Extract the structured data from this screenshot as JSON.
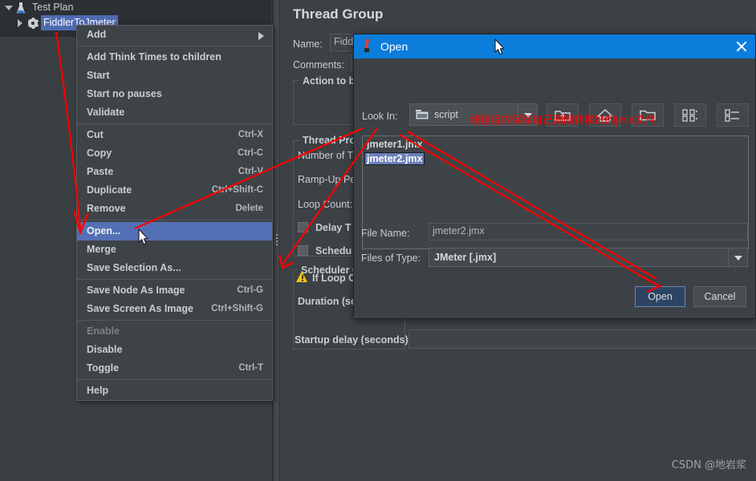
{
  "tree": {
    "nodes": [
      {
        "label": "Test Plan",
        "icon": "flask-icon",
        "expanded": true,
        "selected": false
      },
      {
        "label": "FiddlerToJmeter",
        "icon": "gear-icon",
        "expanded": false,
        "selected": true
      }
    ]
  },
  "main_panel": {
    "title": "Thread Group",
    "name_label": "Name:",
    "name_value": "Fiddl",
    "comments_label": "Comments:",
    "action_group_title": "Action to be",
    "thread_group_title": "Thread Pro",
    "fields": [
      "Number of T",
      "Ramp-Up Pe",
      "Loop Count:"
    ],
    "checkboxes": [
      "Delay T",
      "Schedu"
    ],
    "scheduler_group_title": "Scheduler C",
    "if_loop_label": "If Loop C",
    "duration_label": "Duration (se",
    "startup_delay_label": "Startup delay (seconds)"
  },
  "context_menu": {
    "items": [
      {
        "label": "Add",
        "accel": "",
        "submenu": true,
        "bold": true,
        "highlighted": false,
        "disabled": false,
        "separator_after": true
      },
      {
        "label": "Add Think Times to children",
        "accel": "",
        "submenu": false,
        "bold": true,
        "highlighted": false,
        "disabled": false,
        "separator_after": false
      },
      {
        "label": "Start",
        "accel": "",
        "submenu": false,
        "bold": true,
        "highlighted": false,
        "disabled": false,
        "separator_after": false
      },
      {
        "label": "Start no pauses",
        "accel": "",
        "submenu": false,
        "bold": true,
        "highlighted": false,
        "disabled": false,
        "separator_after": false
      },
      {
        "label": "Validate",
        "accel": "",
        "submenu": false,
        "bold": true,
        "highlighted": false,
        "disabled": false,
        "separator_after": true
      },
      {
        "label": "Cut",
        "accel": "Ctrl-X",
        "submenu": false,
        "bold": true,
        "highlighted": false,
        "disabled": false,
        "separator_after": false
      },
      {
        "label": "Copy",
        "accel": "Ctrl-C",
        "submenu": false,
        "bold": true,
        "highlighted": false,
        "disabled": false,
        "separator_after": false
      },
      {
        "label": "Paste",
        "accel": "Ctrl-V",
        "submenu": false,
        "bold": true,
        "highlighted": false,
        "disabled": false,
        "separator_after": false
      },
      {
        "label": "Duplicate",
        "accel": "Ctrl+Shift-C",
        "submenu": false,
        "bold": true,
        "highlighted": false,
        "disabled": false,
        "separator_after": false
      },
      {
        "label": "Remove",
        "accel": "Delete",
        "submenu": false,
        "bold": true,
        "highlighted": false,
        "disabled": false,
        "separator_after": true
      },
      {
        "label": "Open...",
        "accel": "",
        "submenu": false,
        "bold": true,
        "highlighted": true,
        "disabled": false,
        "separator_after": false
      },
      {
        "label": "Merge",
        "accel": "",
        "submenu": false,
        "bold": true,
        "highlighted": false,
        "disabled": false,
        "separator_after": false
      },
      {
        "label": "Save Selection As...",
        "accel": "",
        "submenu": false,
        "bold": true,
        "highlighted": false,
        "disabled": false,
        "separator_after": true
      },
      {
        "label": "Save Node As Image",
        "accel": "Ctrl-G",
        "submenu": false,
        "bold": true,
        "highlighted": false,
        "disabled": false,
        "separator_after": false
      },
      {
        "label": "Save Screen As Image",
        "accel": "Ctrl+Shift-G",
        "submenu": false,
        "bold": true,
        "highlighted": false,
        "disabled": false,
        "separator_after": true
      },
      {
        "label": "Enable",
        "accel": "",
        "submenu": false,
        "bold": true,
        "highlighted": false,
        "disabled": true,
        "separator_after": false
      },
      {
        "label": "Disable",
        "accel": "",
        "submenu": false,
        "bold": true,
        "highlighted": false,
        "disabled": false,
        "separator_after": false
      },
      {
        "label": "Toggle",
        "accel": "Ctrl-T",
        "submenu": false,
        "bold": true,
        "highlighted": false,
        "disabled": false,
        "separator_after": true
      },
      {
        "label": "Help",
        "accel": "",
        "submenu": false,
        "bold": true,
        "highlighted": false,
        "disabled": false,
        "separator_after": false
      }
    ]
  },
  "dialog": {
    "title": "Open",
    "look_in_label": "Look In:",
    "look_in_value": "script",
    "toolbar": [
      {
        "name": "up-one-level-icon"
      },
      {
        "name": "home-icon"
      },
      {
        "name": "new-folder-icon"
      },
      {
        "name": "grid-view-icon"
      },
      {
        "name": "list-view-icon"
      }
    ],
    "files": [
      {
        "name": "jmeter1.jmx",
        "selected": false
      },
      {
        "name": "jmeter2.jmx",
        "selected": true
      }
    ],
    "file_name_label": "File Name:",
    "file_name_value": "jmeter2.jmx",
    "files_of_type_label": "Files of Type:",
    "files_of_type_value": "JMeter [.jmx]",
    "open_button": "Open",
    "cancel_button": "Cancel"
  },
  "annotation": {
    "text": "线程组内保存自己刚刚转换好的jmx文件",
    "color": "#ff0000"
  },
  "watermark": "CSDN @地岩浆",
  "colors": {
    "window_bg": "#3c4145",
    "tree_bg": "#2b3034",
    "titlebar_blue": "#0b7ddb",
    "selection_blue": "#5470b4",
    "accent_red": "#ff0000"
  }
}
